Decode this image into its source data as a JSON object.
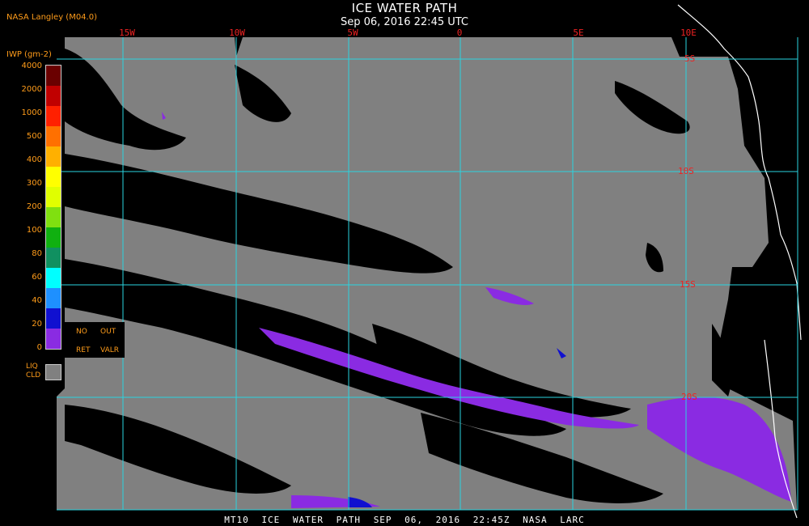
{
  "header": {
    "title": "ICE WATER PATH",
    "datetime": "Sep 06, 2016 22:45 UTC",
    "organization": "NASA Langley (M04.0)"
  },
  "grid": {
    "longitude_labels": [
      "15W",
      "10W",
      "5W",
      "0",
      "5E",
      "10E"
    ],
    "latitude_labels": [
      "5S",
      "10S",
      "15S",
      "20S"
    ],
    "line_color": "#2ad4e0"
  },
  "legend": {
    "units": "IWP (gm-2)",
    "ticks": [
      "4000",
      "2000",
      "1000",
      "500",
      "400",
      "300",
      "200",
      "100",
      "80",
      "60",
      "40",
      "20",
      "0"
    ],
    "colors": [
      "#8a2be2",
      "#1010d0",
      "#1e90ff",
      "#00ffff",
      "#109060",
      "#10b010",
      "#80e010",
      "#e0ff00",
      "#ffff00",
      "#ffb000",
      "#ff7000",
      "#ff2000",
      "#c00000",
      "#6a0000"
    ],
    "no_retrieval": {
      "line1_a": "NO",
      "line1_b": "OUT",
      "line2_a": "RET",
      "line2_b": "VALR"
    },
    "liquid_cloud": {
      "line1": "LIQ",
      "line2": "CLD",
      "color": "#808080"
    }
  },
  "map_colors": {
    "background": "#000000",
    "liquid_cloud": "#808080",
    "coastline": "#ffffff",
    "ice_low": "#8a2be2",
    "ice_mid": "#1010d0"
  },
  "footer": {
    "product": "MT10",
    "name": "ICE WATER PATH",
    "date": "SEP 06, 2016 22:45Z",
    "source": "NASA LARC"
  }
}
